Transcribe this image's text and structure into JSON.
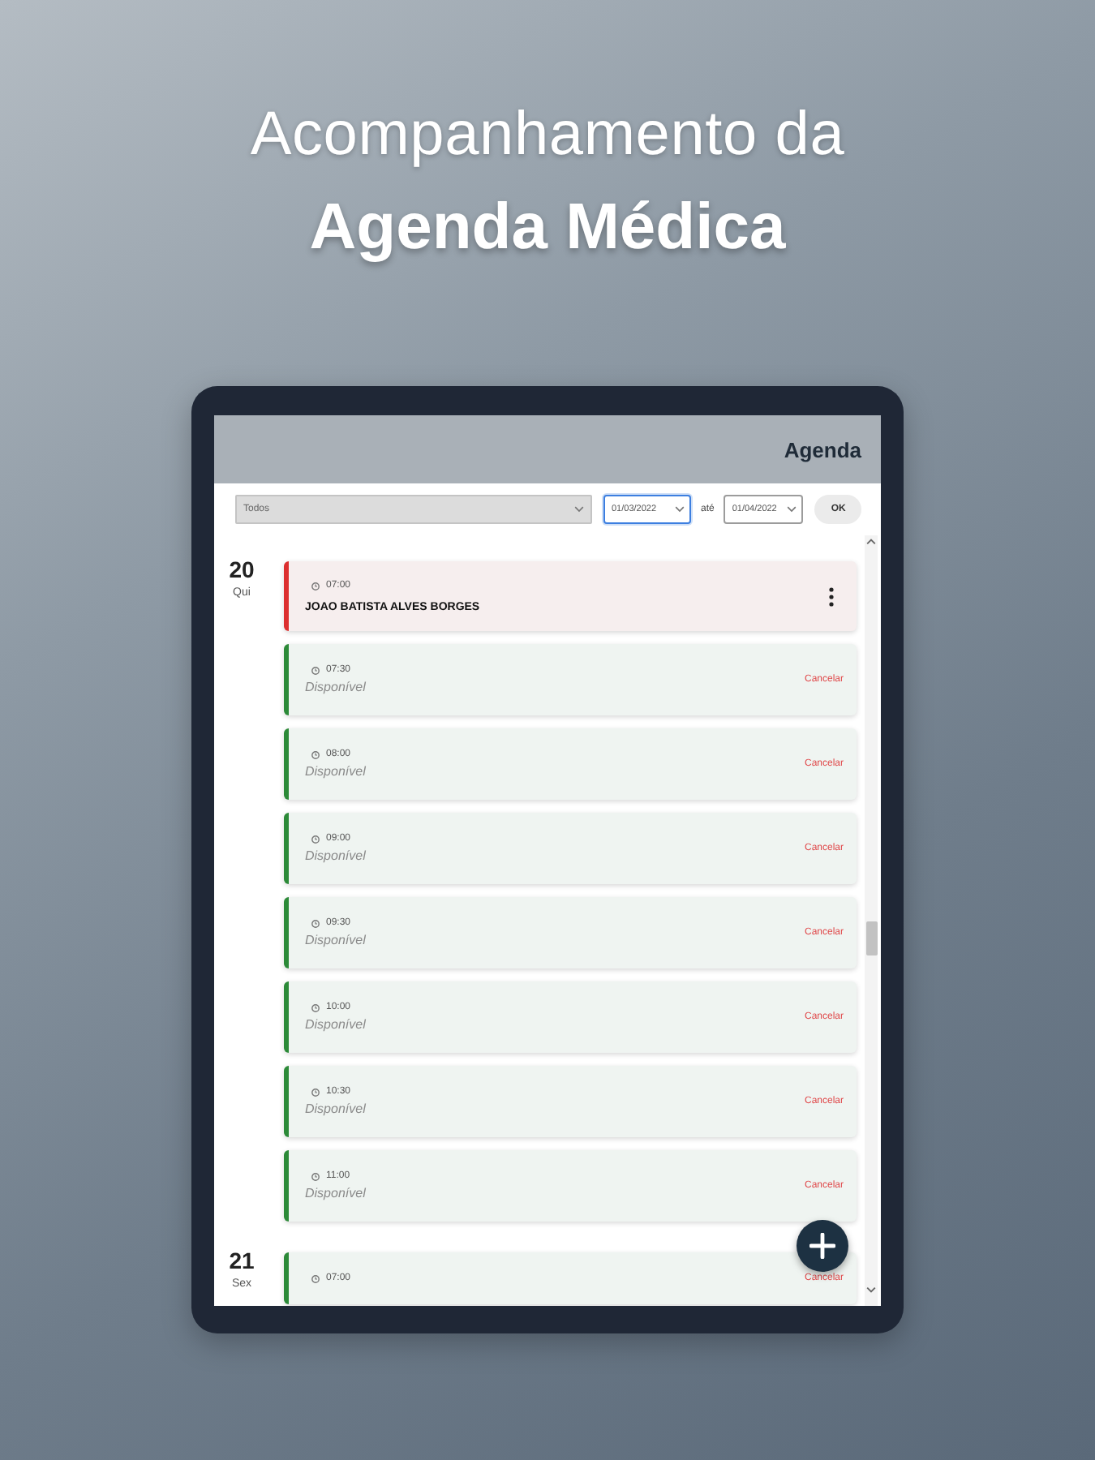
{
  "headline": {
    "line_1": "Acompanhamento da",
    "line_2": "Agenda Médica"
  },
  "app": {
    "title": "Agenda"
  },
  "filter": {
    "professional_select": {
      "value": "Todos"
    },
    "date_from": {
      "value": "01/03/2022",
      "focused": true
    },
    "separator": "até",
    "date_to": {
      "value": "01/04/2022",
      "focused": false
    },
    "ok_button": "OK"
  },
  "days": [
    {
      "day": "20",
      "weekday": "Qui",
      "slots": [
        {
          "kind": "booked",
          "time": "07:00",
          "patient": "JOAO BATISTA ALVES BORGES"
        },
        {
          "kind": "available",
          "time": "07:30",
          "status": "Disponível",
          "action": "Cancelar"
        },
        {
          "kind": "available",
          "time": "08:00",
          "status": "Disponível",
          "action": "Cancelar"
        },
        {
          "kind": "available",
          "time": "09:00",
          "status": "Disponível",
          "action": "Cancelar"
        },
        {
          "kind": "available",
          "time": "09:30",
          "status": "Disponível",
          "action": "Cancelar"
        },
        {
          "kind": "available",
          "time": "10:00",
          "status": "Disponível",
          "action": "Cancelar"
        },
        {
          "kind": "available",
          "time": "10:30",
          "status": "Disponível",
          "action": "Cancelar"
        },
        {
          "kind": "available",
          "time": "11:00",
          "status": "Disponível",
          "action": "Cancelar"
        }
      ]
    },
    {
      "day": "21",
      "weekday": "Sex",
      "slots": [
        {
          "kind": "available",
          "time": "07:00",
          "action": "Cancelar"
        }
      ]
    }
  ]
}
